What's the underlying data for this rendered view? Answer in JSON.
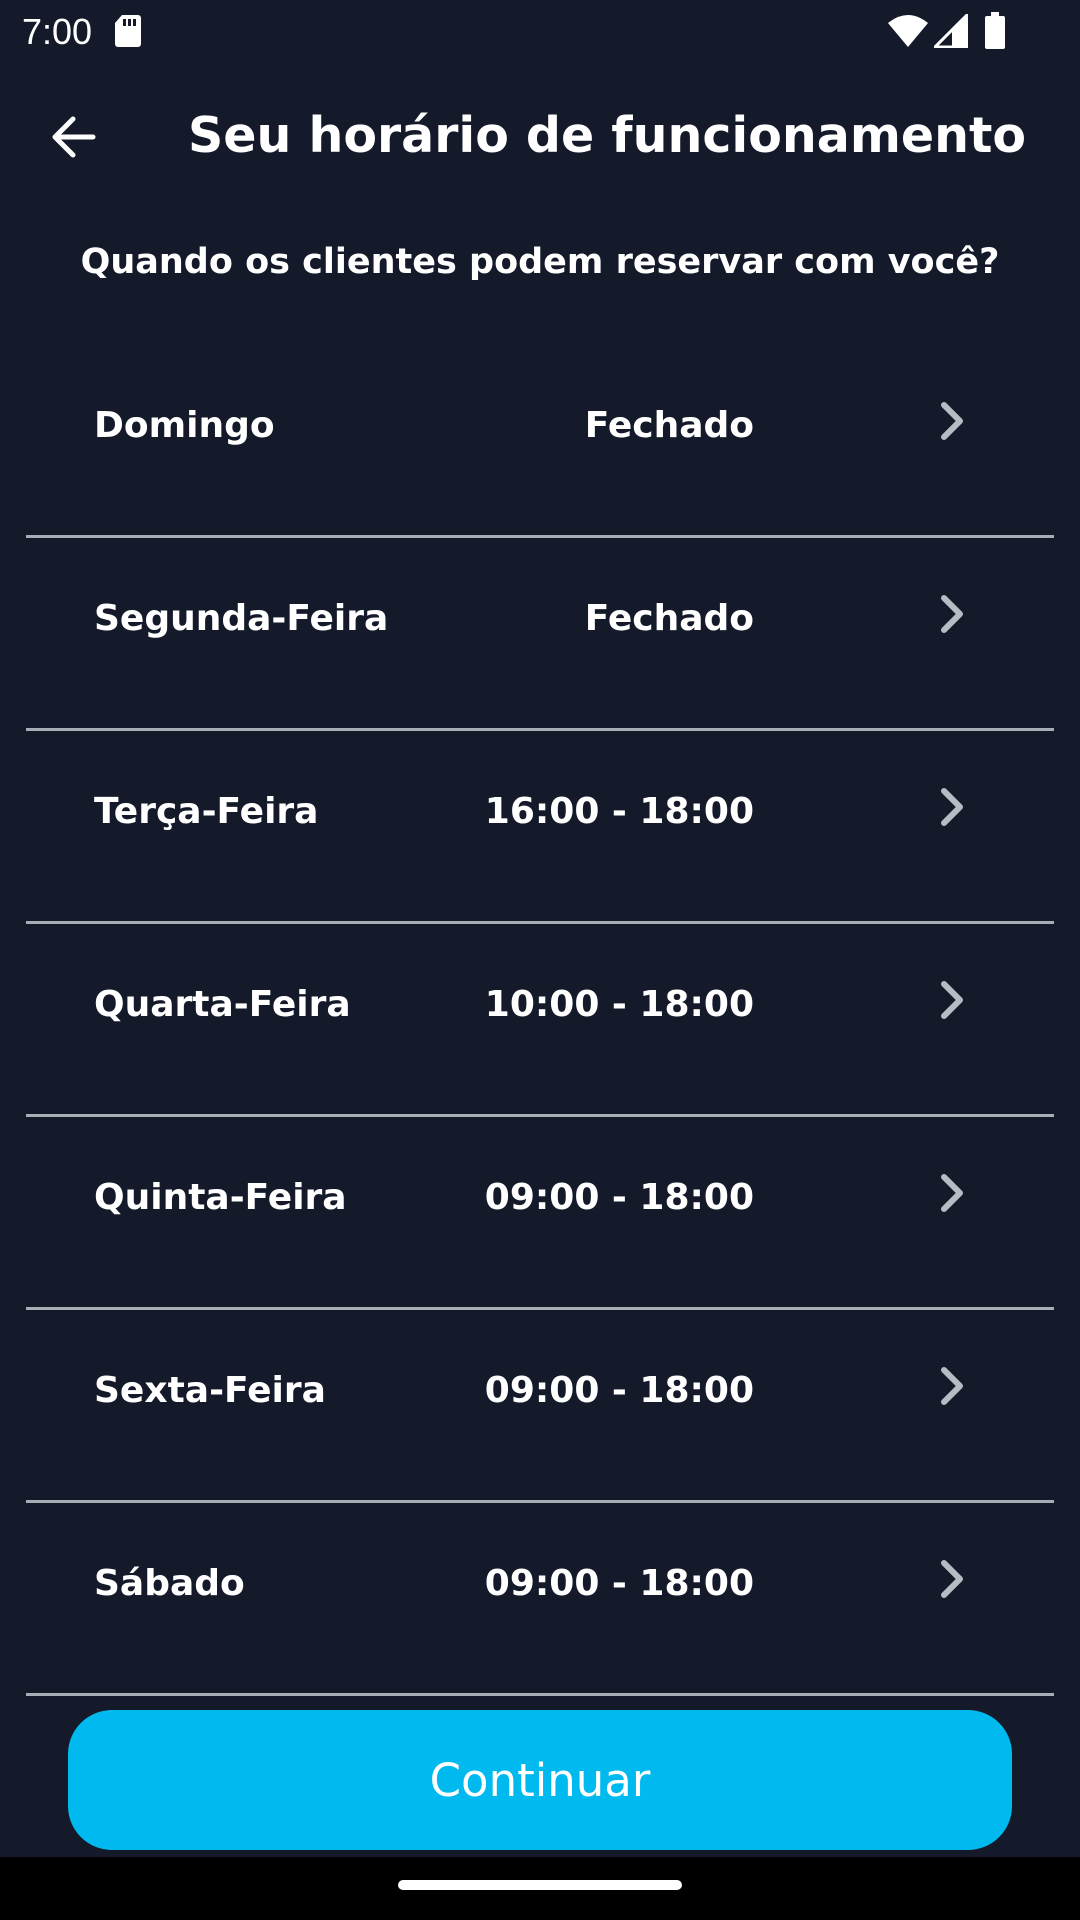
{
  "status_bar": {
    "time": "7:00",
    "icons": [
      "sd-card-icon",
      "wifi-icon",
      "signal-icon",
      "battery-icon"
    ]
  },
  "header": {
    "back_icon": "arrow-left-icon",
    "title": "Seu horário de funcionamento"
  },
  "subtitle": "Quando os clientes podem reservar com você?",
  "schedule": [
    {
      "day": "Domingo",
      "hours": "Fechado"
    },
    {
      "day": "Segunda-Feira",
      "hours": "Fechado"
    },
    {
      "day": "Terça-Feira",
      "hours": "16:00 - 18:00"
    },
    {
      "day": "Quarta-Feira",
      "hours": "10:00 - 18:00"
    },
    {
      "day": "Quinta-Feira",
      "hours": "09:00 - 18:00"
    },
    {
      "day": "Sexta-Feira",
      "hours": "09:00 - 18:00"
    },
    {
      "day": "Sábado",
      "hours": "09:00 - 18:00"
    }
  ],
  "actions": {
    "continue_label": "Continuar"
  },
  "colors": {
    "background": "#141a2a",
    "primary_button": "#00b9ee",
    "divider": "#a9adb6",
    "chevron": "#b7bbc3"
  }
}
